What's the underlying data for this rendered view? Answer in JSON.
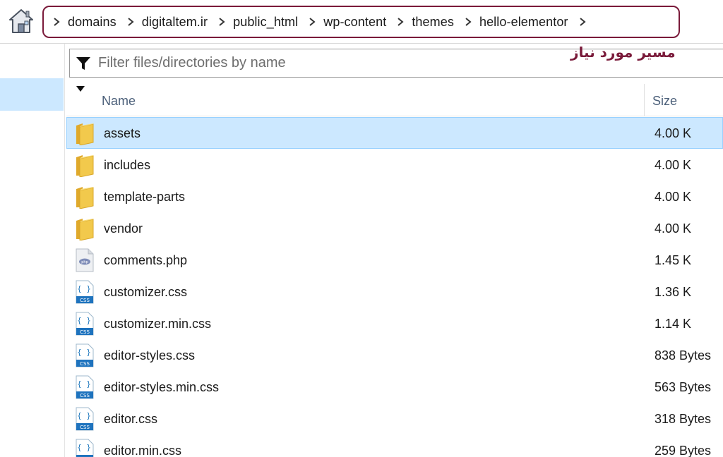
{
  "breadcrumb": [
    "domains",
    "digitaltem.ir",
    "public_html",
    "wp-content",
    "themes",
    "hello-elementor"
  ],
  "annotation": "مسیر مورد نیاز",
  "filter": {
    "placeholder": "Filter files/directories by name",
    "value": ""
  },
  "columns": {
    "name": "Name",
    "size": "Size"
  },
  "files": [
    {
      "name": "assets",
      "size": "4.00 K",
      "type": "folder-icon",
      "selected": true
    },
    {
      "name": "includes",
      "size": "4.00 K",
      "type": "folder-icon"
    },
    {
      "name": "template-parts",
      "size": "4.00 K",
      "type": "folder-icon"
    },
    {
      "name": "vendor",
      "size": "4.00 K",
      "type": "folder-icon"
    },
    {
      "name": "comments.php",
      "size": "1.45 K",
      "type": "php-file-icon"
    },
    {
      "name": "customizer.css",
      "size": "1.36 K",
      "type": "css-file-icon"
    },
    {
      "name": "customizer.min.css",
      "size": "1.14 K",
      "type": "css-file-icon"
    },
    {
      "name": "editor-styles.css",
      "size": "838 Bytes",
      "type": "css-file-icon"
    },
    {
      "name": "editor-styles.min.css",
      "size": "563 Bytes",
      "type": "css-file-icon"
    },
    {
      "name": "editor.css",
      "size": "318 Bytes",
      "type": "css-file-icon"
    },
    {
      "name": "editor.min.css",
      "size": "259 Bytes",
      "type": "css-file-icon"
    }
  ],
  "colors": {
    "selection": "#cce8ff",
    "annotation": "#7a1a3a",
    "header_text": "#4c607a",
    "folder": "#f2c94c"
  }
}
